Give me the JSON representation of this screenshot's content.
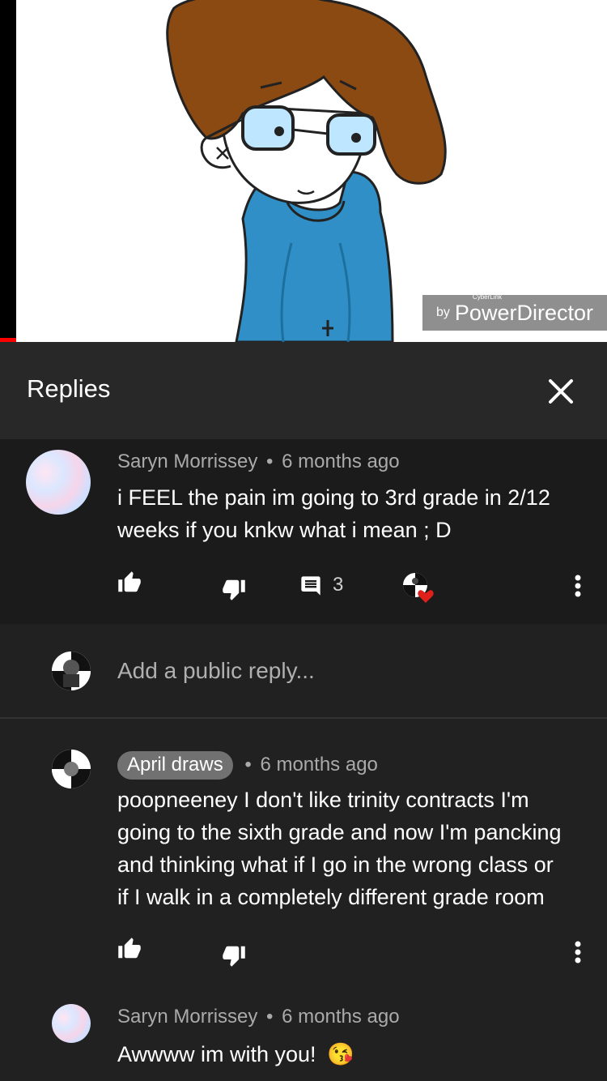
{
  "video": {
    "watermark_by": "by",
    "watermark_small": "CyberLink",
    "watermark_brand": "PowerDirector"
  },
  "header": {
    "title": "Replies",
    "close_icon": "close-icon"
  },
  "parent_comment": {
    "author": "Saryn Morrissey",
    "separator": "•",
    "time": "6 months ago",
    "text_line1": "i FEEL the pain im going to 3rd grade in 2/12",
    "text_line2": "weeks if you knkw what i mean ; D",
    "reply_count": "3",
    "icons": [
      "thumbs-up-icon",
      "thumbs-down-icon",
      "reply-icon",
      "creator-heart-icon",
      "more-vert-icon"
    ]
  },
  "add_reply": {
    "placeholder": "Add a public reply..."
  },
  "replies": [
    {
      "author": "April draws",
      "separator": "•",
      "time": "6 months ago",
      "text_lines": [
        "poopneeney I don't like trinity contracts I'm",
        "going to the sixth grade and now I'm pancking",
        "and thinking what if I go in the wrong class or",
        "if I walk in a completely different grade room"
      ]
    },
    {
      "author": "Saryn Morrissey",
      "separator": "•",
      "time": "6 months ago",
      "text": "Awwww im with you!",
      "emoji": "😘"
    }
  ],
  "colors": {
    "background": "#212121",
    "header": "#282828",
    "parent_bg": "#1b1b1b",
    "meta": "#aaaaaa",
    "pill": "#717171"
  }
}
